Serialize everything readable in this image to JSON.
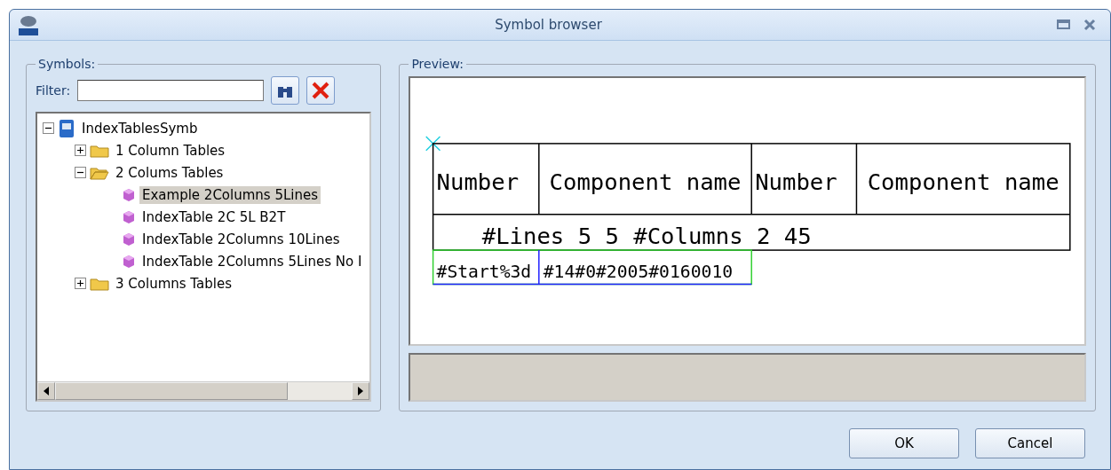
{
  "window": {
    "title": "Symbol browser"
  },
  "symbols": {
    "label": "Symbols:",
    "filter_label": "Filter:",
    "tree": [
      {
        "label": "IndexTablesSymb",
        "kind": "root",
        "expanded": true,
        "selected": false,
        "children": [
          {
            "label": "1 Column Tables",
            "kind": "folder",
            "expanded": false,
            "selected": false
          },
          {
            "label": "2 Colums Tables",
            "kind": "folder",
            "expanded": true,
            "selected": false,
            "children": [
              {
                "label": "Example 2Columns 5Lines",
                "kind": "symbol",
                "selected": true
              },
              {
                "label": "IndexTable 2C 5L B2T",
                "kind": "symbol",
                "selected": false
              },
              {
                "label": "IndexTable 2Columns 10Lines",
                "kind": "symbol",
                "selected": false
              },
              {
                "label": "IndexTable 2Columns 5Lines No I",
                "kind": "symbol",
                "selected": false
              }
            ]
          },
          {
            "label": "3 Columns Tables",
            "kind": "folder",
            "expanded": false,
            "selected": false
          }
        ]
      }
    ]
  },
  "preview": {
    "label": "Preview:",
    "headers": [
      "Number",
      "Component name",
      "Number",
      "Component name"
    ],
    "row_texts": [
      "#Lines 5 5",
      "#Columns 2 45"
    ],
    "start_texts": [
      "#Start%3d",
      "#14#0#2005#0160010"
    ]
  },
  "buttons": [
    "OK",
    "Cancel"
  ]
}
